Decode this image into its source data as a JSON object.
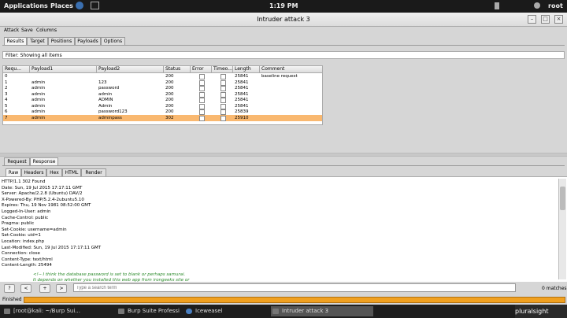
{
  "top": {
    "applications": "Applications",
    "places": "Places",
    "clock": "1:19 PM",
    "user": "root"
  },
  "window": {
    "title": "Intruder attack 3"
  },
  "menu": [
    "Attack",
    "Save",
    "Columns"
  ],
  "tabs": [
    "Results",
    "Target",
    "Positions",
    "Payloads",
    "Options"
  ],
  "filter": "Filter: Showing all items",
  "table": {
    "headers": [
      "Requ...",
      "Payload1",
      "Payload2",
      "Status",
      "Error",
      "Timeo...",
      "Length",
      "Comment"
    ],
    "rows": [
      [
        "0",
        "",
        "",
        "200",
        "",
        "",
        "25841",
        "baseline request"
      ],
      [
        "1",
        "admin",
        "123",
        "200",
        "",
        "",
        "25841",
        ""
      ],
      [
        "2",
        "admin",
        "password",
        "200",
        "",
        "",
        "25841",
        ""
      ],
      [
        "3",
        "admin",
        "admin",
        "200",
        "",
        "",
        "25841",
        ""
      ],
      [
        "4",
        "admin",
        "ADMIN",
        "200",
        "",
        "",
        "25841",
        ""
      ],
      [
        "5",
        "admin",
        "Admin",
        "200",
        "",
        "",
        "25841",
        ""
      ],
      [
        "6",
        "admin",
        "password123",
        "200",
        "",
        "",
        "25839",
        ""
      ],
      [
        "7",
        "admin",
        "adminpass",
        "302",
        "",
        "",
        "25910",
        ""
      ]
    ],
    "selected_row": 7
  },
  "reqtabs": [
    "Request",
    "Response"
  ],
  "viewtabs": [
    "Raw",
    "Headers",
    "Hex",
    "HTML",
    "Render"
  ],
  "response": [
    "HTTP/1.1 302 Found",
    "Date: Sun, 19 Jul 2015 17:17:11 GMT",
    "Server: Apache/2.2.8 (Ubuntu) DAV/2",
    "X-Powered-By: PHP/5.2.4-2ubuntu5.10",
    "Expires: Thu, 19 Nov 1981 08:52:00 GMT",
    "Logged-In-User: admin",
    "Cache-Control: public",
    "Pragma: public",
    "Set-Cookie: username=admin",
    "Set-Cookie: uid=1",
    "Location: index.php",
    "Last-Modified: Sun, 19 Jul 2015 17:17:11 GMT",
    "Connection: close",
    "Content-Type: text/html",
    "Content-Length: 25494"
  ],
  "comments": [
    "<!-- I think the database password is set to blank or perhaps samurai.",
    "It depends on whether you installed this web app from irongeeks site or"
  ],
  "search": {
    "placeholder": "Type a search term",
    "buttons": [
      "?",
      "<",
      "+",
      ">"
    ],
    "matches": "0 matches"
  },
  "status": "Finished",
  "taskbar": [
    "[root@kali: ~/Burp Sui...",
    "Burp Suite Professio...",
    "Iceweasel",
    "Intruder attack 3"
  ],
  "watermark": "pluralsight"
}
